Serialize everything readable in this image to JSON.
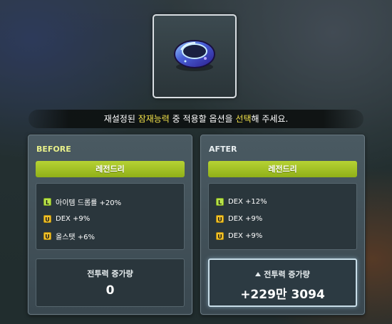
{
  "item": {
    "icon": "ring-icon"
  },
  "notice": {
    "part1": "재설정된 ",
    "hl1": "잠재능력",
    "part2": " 중 적용할 옵션을 ",
    "hl2": "선택",
    "part3": "해 주세요."
  },
  "before": {
    "title": "BEFORE",
    "grade": "레전드리",
    "options": [
      {
        "badge": "L",
        "text": "아이템 드롭률 +20%"
      },
      {
        "badge": "U",
        "text": "DEX +9%"
      },
      {
        "badge": "U",
        "text": "올스탯 +6%"
      }
    ],
    "power_label": "전투력 증가량",
    "power_value": "0"
  },
  "after": {
    "title": "AFTER",
    "grade": "레전드리",
    "options": [
      {
        "badge": "L",
        "text": "DEX +12%"
      },
      {
        "badge": "U",
        "text": "DEX +9%"
      },
      {
        "badge": "U",
        "text": "DEX +9%"
      }
    ],
    "power_label": "전투력 증가량",
    "power_value": "+229만 3094"
  },
  "colors": {
    "grade": "#a4c226",
    "highlight": "#f2e24a",
    "badge_legendary": "#b8e24a",
    "badge_unique": "#f2c22a"
  }
}
